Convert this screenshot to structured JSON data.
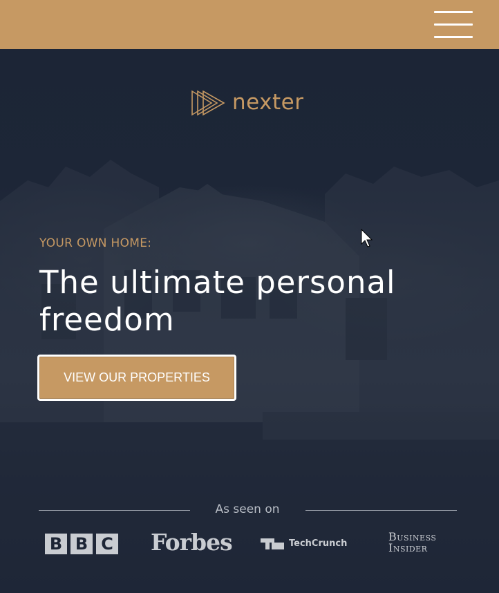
{
  "header": {
    "background_color": "#c69963",
    "menu_icon": "hamburger-menu-icon"
  },
  "logo": {
    "icon": "triple-play-triangle-icon",
    "text": "nexter",
    "color": "#c69963"
  },
  "hero": {
    "eyebrow": "YOUR OWN HOME:",
    "headline": "The ultimate personal freedom",
    "cta_label": "VIEW OUR PROPERTIES",
    "background_color": "#1b2434"
  },
  "seen_on": {
    "label": "As seen on",
    "brands": {
      "bbc": [
        "B",
        "B",
        "C"
      ],
      "forbes": "Forbes",
      "techcrunch": "TechCrunch",
      "business_insider_line1": "Business",
      "business_insider_line2": "Insider"
    }
  }
}
